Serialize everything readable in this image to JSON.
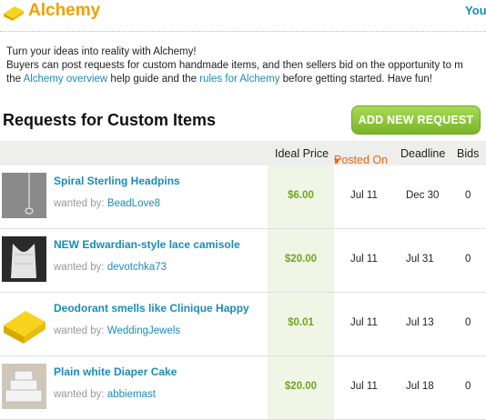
{
  "header": {
    "brand": "Alchemy",
    "right_link": "Your"
  },
  "intro": {
    "line1": "Turn your ideas into reality with Alchemy!",
    "line2": "Buyers can post requests for custom handmade items, and then sellers bid on the opportunity to m",
    "line3_pre": "the ",
    "link1": "Alchemy overview",
    "line3_mid": " help guide and the ",
    "link2": "rules for Alchemy",
    "line3_post": " before getting started. Have fun!"
  },
  "section": {
    "title": "Requests for Custom Items",
    "add_button": "ADD NEW REQUEST"
  },
  "columns": {
    "price": "Ideal Price",
    "posted": "Posted On",
    "posted_sort": "▾",
    "deadline": "Deadline",
    "bids": "Bids"
  },
  "requests": [
    {
      "title": "Spiral Sterling Headpins",
      "wanted_by_label": "wanted by: ",
      "user": "BeadLove8",
      "price": "$6.00",
      "posted": "Jul 11",
      "deadline": "Dec 30",
      "bids": "0"
    },
    {
      "title": "NEW Edwardian-style lace camisole",
      "wanted_by_label": "wanted by: ",
      "user": "devotchka73",
      "price": "$20.00",
      "posted": "Jul 11",
      "deadline": "Jul 31",
      "bids": "0"
    },
    {
      "title": "Deodorant smells like Clinique Happy",
      "wanted_by_label": "wanted by: ",
      "user": "WeddingJewels",
      "price": "$0.01",
      "posted": "Jul 11",
      "deadline": "Jul 13",
      "bids": "0"
    },
    {
      "title": "Plain white Diaper Cake",
      "wanted_by_label": "wanted by: ",
      "user": "abbiemast",
      "price": "$20.00",
      "posted": "Jul 11",
      "deadline": "Jul 18",
      "bids": "0"
    }
  ],
  "colors": {
    "accent_blue": "#1a8cb8",
    "brand_orange": "#f0a008",
    "price_green": "#6ea620",
    "button_green": "#8cc63f"
  }
}
